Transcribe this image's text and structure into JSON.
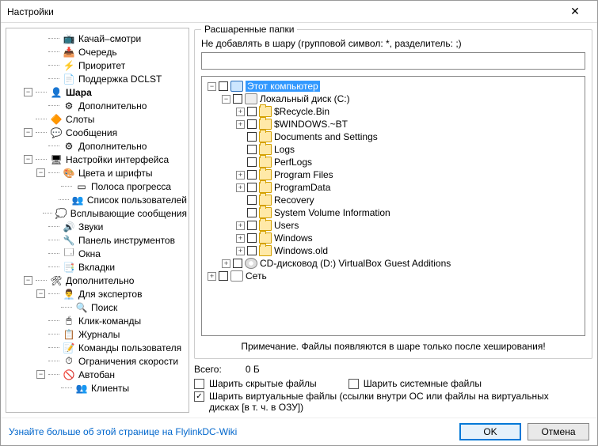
{
  "window": {
    "title": "Настройки"
  },
  "leftTree": [
    {
      "depth": 2,
      "exp": "",
      "icon": "📺",
      "label": "Качай–смотри"
    },
    {
      "depth": 2,
      "exp": "",
      "icon": "📥",
      "label": "Очередь"
    },
    {
      "depth": 2,
      "exp": "",
      "icon": "⚡",
      "label": "Приоритет"
    },
    {
      "depth": 2,
      "exp": "",
      "icon": "📄",
      "label": "Поддержка DCLST"
    },
    {
      "depth": 1,
      "exp": "-",
      "icon": "👤",
      "label": "Шара",
      "bold": true
    },
    {
      "depth": 2,
      "exp": "",
      "icon": "⚙",
      "label": "Дополнительно"
    },
    {
      "depth": 1,
      "exp": "",
      "icon": "🔶",
      "label": "Слоты"
    },
    {
      "depth": 1,
      "exp": "-",
      "icon": "💬",
      "label": "Сообщения"
    },
    {
      "depth": 2,
      "exp": "",
      "icon": "⚙",
      "label": "Дополнительно"
    },
    {
      "depth": 1,
      "exp": "-",
      "icon": "🖥",
      "label": "Настройки интерфейса"
    },
    {
      "depth": 2,
      "exp": "-",
      "icon": "🎨",
      "label": "Цвета и шрифты"
    },
    {
      "depth": 3,
      "exp": "",
      "icon": "▭",
      "label": "Полоса прогресса"
    },
    {
      "depth": 3,
      "exp": "",
      "icon": "👥",
      "label": "Список пользователей"
    },
    {
      "depth": 2,
      "exp": "",
      "icon": "💭",
      "label": "Всплывающие сообщения"
    },
    {
      "depth": 2,
      "exp": "",
      "icon": "🔊",
      "label": "Звуки"
    },
    {
      "depth": 2,
      "exp": "",
      "icon": "🔧",
      "label": "Панель инструментов"
    },
    {
      "depth": 2,
      "exp": "",
      "icon": "🗔",
      "label": "Окна"
    },
    {
      "depth": 2,
      "exp": "",
      "icon": "📑",
      "label": "Вкладки"
    },
    {
      "depth": 1,
      "exp": "-",
      "icon": "🛠",
      "label": "Дополнительно"
    },
    {
      "depth": 2,
      "exp": "-",
      "icon": "👨‍💼",
      "label": "Для экспертов"
    },
    {
      "depth": 3,
      "exp": "",
      "icon": "🔍",
      "label": "Поиск"
    },
    {
      "depth": 2,
      "exp": "",
      "icon": "🖱",
      "label": "Клик-команды"
    },
    {
      "depth": 2,
      "exp": "",
      "icon": "📋",
      "label": "Журналы"
    },
    {
      "depth": 2,
      "exp": "",
      "icon": "📝",
      "label": "Команды пользователя"
    },
    {
      "depth": 2,
      "exp": "",
      "icon": "⏱",
      "label": "Ограничения скорости"
    },
    {
      "depth": 2,
      "exp": "-",
      "icon": "🚫",
      "label": "Автобан"
    },
    {
      "depth": 3,
      "exp": "",
      "icon": "👥",
      "label": "Клиенты"
    }
  ],
  "share": {
    "groupTitle": "Расшаренные папки",
    "excludeLabel": "Не добавлять в шару (групповой символ: *, разделитель: ;)",
    "excludeValue": "",
    "note": "Примечание. Файлы появляются в шаре только после хеширования!",
    "totalLabel": "Всего:",
    "totalValue": "0 Б",
    "cbHidden": "Шарить скрытые файлы",
    "cbSystem": "Шарить системные файлы",
    "cbVirtual": "Шарить виртуальные файлы (ссылки внутри ОС или файлы на виртуальных дисках [в т. ч. в ОЗУ])",
    "cbVirtualChecked": true,
    "tree": [
      {
        "depth": 0,
        "exp": "-",
        "kind": "comp",
        "label": "Этот компьютер",
        "selected": true
      },
      {
        "depth": 1,
        "exp": "-",
        "kind": "disk",
        "label": "Локальный диск (C:)"
      },
      {
        "depth": 2,
        "exp": "+",
        "kind": "folder",
        "label": "$Recycle.Bin"
      },
      {
        "depth": 2,
        "exp": "+",
        "kind": "folder",
        "label": "$WINDOWS.~BT"
      },
      {
        "depth": 2,
        "exp": "",
        "kind": "folder",
        "label": "Documents and Settings"
      },
      {
        "depth": 2,
        "exp": "",
        "kind": "folder",
        "label": "Logs"
      },
      {
        "depth": 2,
        "exp": "",
        "kind": "folder",
        "label": "PerfLogs"
      },
      {
        "depth": 2,
        "exp": "+",
        "kind": "folder",
        "label": "Program Files"
      },
      {
        "depth": 2,
        "exp": "+",
        "kind": "folder",
        "label": "ProgramData"
      },
      {
        "depth": 2,
        "exp": "",
        "kind": "folder",
        "label": "Recovery"
      },
      {
        "depth": 2,
        "exp": "",
        "kind": "folder",
        "label": "System Volume Information"
      },
      {
        "depth": 2,
        "exp": "+",
        "kind": "folder",
        "label": "Users"
      },
      {
        "depth": 2,
        "exp": "+",
        "kind": "folder",
        "label": "Windows"
      },
      {
        "depth": 2,
        "exp": "+",
        "kind": "folder",
        "label": "Windows.old"
      },
      {
        "depth": 1,
        "exp": "+",
        "kind": "cd",
        "label": "CD-дисковод (D:) VirtualBox Guest Additions"
      },
      {
        "depth": 0,
        "exp": "+",
        "kind": "net",
        "label": "Сеть"
      }
    ]
  },
  "footer": {
    "link": "Узнайте больше об этой странице на FlylinkDC-Wiki",
    "ok": "OK",
    "cancel": "Отмена"
  }
}
